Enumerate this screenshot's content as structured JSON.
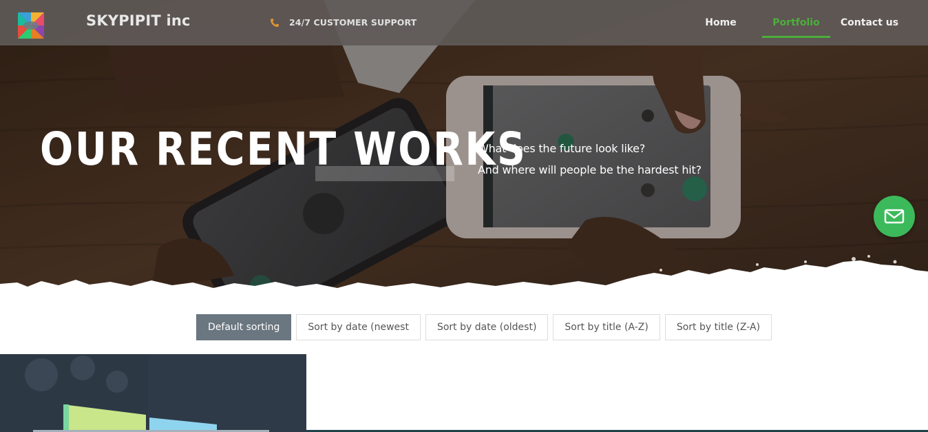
{
  "header": {
    "brand": "SKYPIPIT inc",
    "support_label": "24/7 CUSTOMER SUPPORT",
    "nav": [
      {
        "label": "Home",
        "active": false
      },
      {
        "label": "Portfolio",
        "active": true
      },
      {
        "label": "Contact us",
        "active": false
      }
    ]
  },
  "hero": {
    "title": "OUR RECENT WORKS",
    "subtitle_line1": "What does the future look like?",
    "subtitle_line2": "And where will people be the hardest hit?"
  },
  "sorting": {
    "options": [
      {
        "label": "Default sorting",
        "active": true
      },
      {
        "label": "Sort by date (newest",
        "active": false
      },
      {
        "label": "Sort by date (oldest)",
        "active": false
      },
      {
        "label": "Sort by title (A-Z)",
        "active": false
      },
      {
        "label": "Sort by title (Z-A)",
        "active": false
      }
    ]
  },
  "icons": {
    "phone": "phone-icon",
    "mail": "mail-icon"
  },
  "colors": {
    "accent_green": "#4caf3a",
    "fab_green": "#3cb95a",
    "sort_active": "#6a7680"
  }
}
